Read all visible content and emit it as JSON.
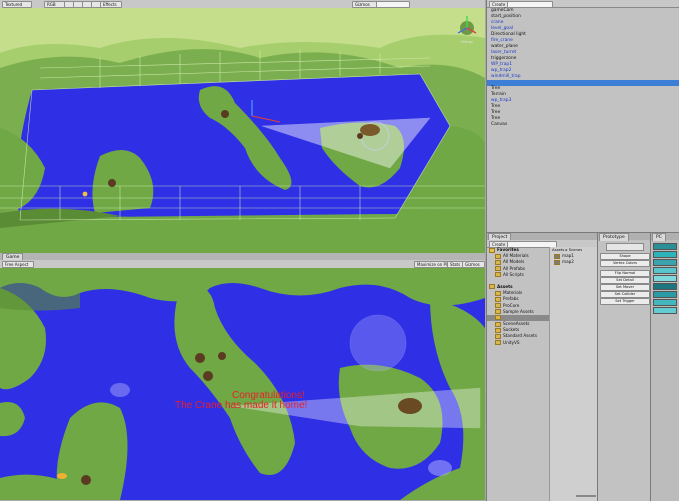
{
  "scene": {
    "mode_select": "Textured",
    "rgb_select": "RGB",
    "effects_label": "Effects",
    "gizmos_label": "Gizmos",
    "persp_label": "<Persp"
  },
  "game": {
    "tab_label": "Game",
    "aspect_select": "Free Aspect",
    "maximize_label": "Maximize on Play",
    "stats_label": "Stats",
    "gizmos_label": "Gizmos",
    "message_line1": "Congratulations!",
    "message_line2": "The Crane has made it home!"
  },
  "hierarchy": {
    "create_label": "Create",
    "items": [
      {
        "label": "gameCam",
        "color": "black"
      },
      {
        "label": "start_position",
        "color": "black"
      },
      {
        "label": "crane",
        "color": "blue"
      },
      {
        "label": "level_goal",
        "color": "blue"
      },
      {
        "label": "Directional light",
        "color": "black"
      },
      {
        "label": "fire_crane",
        "color": "blue"
      },
      {
        "label": "water_plane",
        "color": "black"
      },
      {
        "label": "laser_turret",
        "color": "blue"
      },
      {
        "label": "triggerzone",
        "color": "black"
      },
      {
        "label": "WP_trap1",
        "color": "blue"
      },
      {
        "label": "wp_trap2",
        "color": "blue"
      },
      {
        "label": "windmill_trap",
        "color": "blue"
      },
      {
        "label": "",
        "color": "selected"
      },
      {
        "label": "Tree",
        "color": "black"
      },
      {
        "label": "Terrain",
        "color": "black"
      },
      {
        "label": "wp_trap3",
        "color": "blue"
      },
      {
        "label": "Tree",
        "color": "black"
      },
      {
        "label": "Tree",
        "color": "black"
      },
      {
        "label": "Tree",
        "color": "black"
      },
      {
        "label": "Canvas",
        "color": "black"
      }
    ]
  },
  "project": {
    "tab_label": "Project",
    "create_label": "Create",
    "favorites_label": "Favorites",
    "favorites": [
      "All Materials",
      "All Models",
      "All Prefabs",
      "All Scripts"
    ],
    "assets_label": "Assets",
    "assets": [
      "Materials",
      "Prefabs",
      "ProCore",
      "Sample Assets",
      "",
      "SceneAssets",
      "Sockets",
      "Standard Assets",
      "UnityVS"
    ],
    "breadcrumb_assets": "Assets",
    "breadcrumb_scenes": "Scenes",
    "scenes": [
      "map1",
      "map2"
    ]
  },
  "prototype": {
    "tab_label": "Prototype",
    "buttons": [
      "Shape",
      "Vertex Colors",
      "Flip Normal",
      "Set Detail",
      "Set Mover",
      "Set Collider",
      "Set Trigger"
    ]
  },
  "palette": {
    "tab_label": "PC",
    "swatches": [
      "#2a8f96",
      "#2fb3ba",
      "#3aa4ae",
      "#58c4cc",
      "#7fd8de",
      "#1c7680",
      "#2a9aa4",
      "#44b6be",
      "#63ccd2"
    ]
  },
  "colors": {
    "water": "#2f2fe6",
    "terrain": "#6fa844",
    "terrain_dark": "#4e7e2e",
    "selection": "#3d7fd6",
    "message": "#e8202a"
  }
}
